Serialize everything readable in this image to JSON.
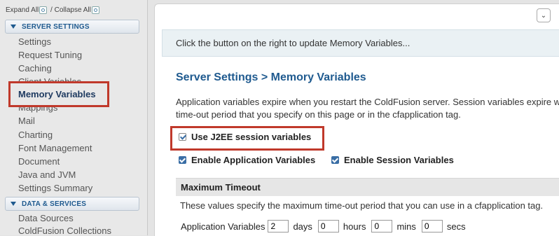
{
  "sidebar": {
    "expand_all": "Expand All",
    "separator": " / ",
    "collapse_all": "Collapse All",
    "server_settings_header": "SERVER SETTINGS",
    "server_items": [
      "Settings",
      "Request Tuning",
      "Caching",
      "Client Variables",
      "Memory Variables",
      "Mappings",
      "Mail",
      "Charting",
      "Font Management",
      "Document",
      "Java and JVM",
      "Settings Summary"
    ],
    "active_item": "Memory Variables",
    "data_services_header": "DATA & SERVICES",
    "data_items": [
      "Data Sources",
      "ColdFusion Collections"
    ]
  },
  "main": {
    "dropdown_icon": "chevron-down-icon",
    "info_text": "Click the button on the right to update Memory Variables...",
    "title": "Server Settings > Memory Variables",
    "description_line1": "Application variables expire when you restart the ColdFusion server. Session variables expire w",
    "description_line2": "time-out period that you specify on this page or in the cfapplication tag.",
    "j2ee_label": "Use J2EE session variables",
    "enable_app_label": "Enable Application Variables",
    "enable_session_label": "Enable Session Variables",
    "max_timeout_header": "Maximum Timeout",
    "timeout_desc": "These values specify the maximum time-out period that you can use in a cfapplication tag.",
    "app_vars": {
      "label": "Application Variables",
      "days_value": "2",
      "days_label": "days",
      "hours_value": "0",
      "hours_label": "hours",
      "mins_value": "0",
      "mins_label": "mins",
      "secs_value": "0",
      "secs_label": "secs"
    }
  },
  "colors": {
    "accent_blue": "#1f5a8f",
    "highlight_red": "#c0392b",
    "checkbox_blue": "#3a6ea5"
  }
}
